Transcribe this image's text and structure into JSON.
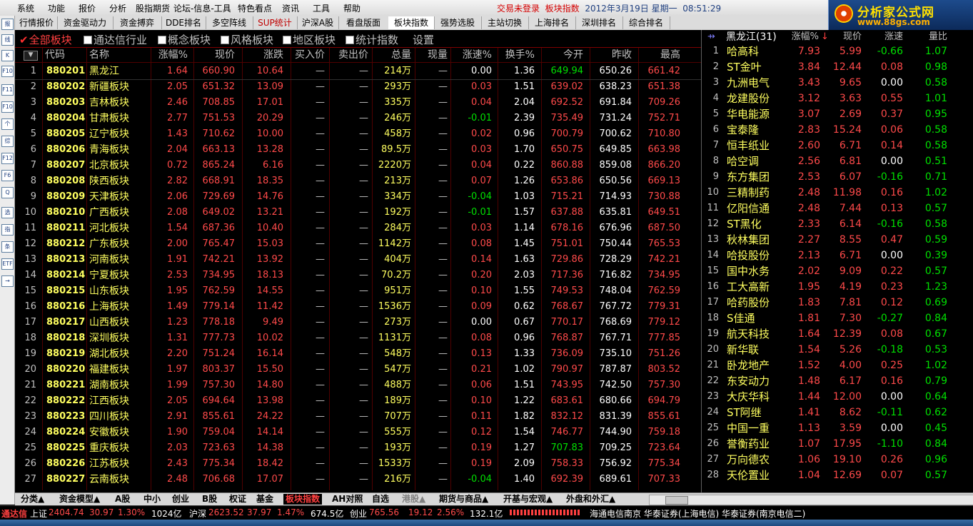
{
  "menu": [
    "系统",
    "功能",
    "报价",
    "分析",
    "股指期货",
    "论坛-信息-工具",
    "特色看点",
    "资讯",
    "工具",
    "帮助"
  ],
  "status": {
    "login": "交易未登录",
    "view": "板块指数",
    "date": "2012年3月19日 星期一",
    "time": "08:51:29"
  },
  "brand": {
    "name": "分析家公式网",
    "url": "www.88gs.com"
  },
  "tabs": [
    "行情报价",
    "资金驱动力",
    "资金搏弈",
    "DDE排名",
    "多空阵线",
    "SUP统计",
    "沪深A股",
    "看盘版面",
    "板块指数",
    "强势选股",
    "主站切换",
    "上海排名",
    "深圳排名",
    "综合排名"
  ],
  "active_tab": "板块指数",
  "left_tools": [
    "报",
    "线",
    "K",
    "F10",
    "F11",
    "F10",
    "个",
    "综",
    "F12",
    "F6",
    "Q",
    "选",
    "指",
    "条",
    "ETF",
    "→"
  ],
  "filters": {
    "all": "全部板块",
    "tdx": "通达信行业",
    "concept": "概念板块",
    "style": "风格板块",
    "region": "地区板块",
    "stats": "统计指数",
    "settings": "设置"
  },
  "table": {
    "headers": [
      "代码",
      "名称",
      "涨幅%",
      "现价",
      "涨跌",
      "买入价",
      "卖出价",
      "总量",
      "现量",
      "涨速%",
      "换手%",
      "今开",
      "昨收",
      "最高"
    ],
    "rows": [
      [
        "1",
        "880201",
        "黑龙江",
        "1.64",
        "660.90",
        "10.64",
        "—",
        "—",
        "214",
        "万",
        "—",
        "0.00",
        "1.36",
        "649.94",
        "650.26",
        "661.42"
      ],
      [
        "2",
        "880202",
        "新疆板块",
        "2.05",
        "651.32",
        "13.09",
        "—",
        "—",
        "293",
        "万",
        "—",
        "0.03",
        "1.51",
        "639.02",
        "638.23",
        "651.38"
      ],
      [
        "3",
        "880203",
        "吉林板块",
        "2.46",
        "708.85",
        "17.01",
        "—",
        "—",
        "335",
        "万",
        "—",
        "0.04",
        "2.04",
        "692.52",
        "691.84",
        "709.26"
      ],
      [
        "4",
        "880204",
        "甘肃板块",
        "2.77",
        "751.53",
        "20.29",
        "—",
        "—",
        "246",
        "万",
        "—",
        "-0.01",
        "2.39",
        "735.49",
        "731.24",
        "752.71"
      ],
      [
        "5",
        "880205",
        "辽宁板块",
        "1.43",
        "710.62",
        "10.00",
        "—",
        "—",
        "458",
        "万",
        "—",
        "0.02",
        "0.96",
        "700.79",
        "700.62",
        "710.80"
      ],
      [
        "6",
        "880206",
        "青海板块",
        "2.04",
        "663.13",
        "13.28",
        "—",
        "—",
        "89.5",
        "万",
        "—",
        "0.03",
        "1.70",
        "650.75",
        "649.85",
        "663.98"
      ],
      [
        "7",
        "880207",
        "北京板块",
        "0.72",
        "865.24",
        "6.16",
        "—",
        "—",
        "2220",
        "万",
        "—",
        "0.04",
        "0.22",
        "860.88",
        "859.08",
        "866.20"
      ],
      [
        "8",
        "880208",
        "陕西板块",
        "2.82",
        "668.91",
        "18.35",
        "—",
        "—",
        "213",
        "万",
        "—",
        "0.07",
        "1.26",
        "653.86",
        "650.56",
        "669.13"
      ],
      [
        "9",
        "880209",
        "天津板块",
        "2.06",
        "729.69",
        "14.76",
        "—",
        "—",
        "334",
        "万",
        "—",
        "-0.04",
        "1.03",
        "715.21",
        "714.93",
        "730.88"
      ],
      [
        "10",
        "880210",
        "广西板块",
        "2.08",
        "649.02",
        "13.21",
        "—",
        "—",
        "192",
        "万",
        "—",
        "-0.01",
        "1.57",
        "637.88",
        "635.81",
        "649.51"
      ],
      [
        "11",
        "880211",
        "河北板块",
        "1.54",
        "687.36",
        "10.40",
        "—",
        "—",
        "284",
        "万",
        "—",
        "0.03",
        "1.14",
        "678.16",
        "676.96",
        "687.50"
      ],
      [
        "12",
        "880212",
        "广东板块",
        "2.00",
        "765.47",
        "15.03",
        "—",
        "—",
        "1142",
        "万",
        "—",
        "0.08",
        "1.45",
        "751.01",
        "750.44",
        "765.53"
      ],
      [
        "13",
        "880213",
        "河南板块",
        "1.91",
        "742.21",
        "13.92",
        "—",
        "—",
        "404",
        "万",
        "—",
        "0.14",
        "1.63",
        "729.86",
        "728.29",
        "742.21"
      ],
      [
        "14",
        "880214",
        "宁夏板块",
        "2.53",
        "734.95",
        "18.13",
        "—",
        "—",
        "70.2",
        "万",
        "—",
        "0.20",
        "2.03",
        "717.36",
        "716.82",
        "734.95"
      ],
      [
        "15",
        "880215",
        "山东板块",
        "1.95",
        "762.59",
        "14.55",
        "—",
        "—",
        "951",
        "万",
        "—",
        "0.10",
        "1.55",
        "749.53",
        "748.04",
        "762.59"
      ],
      [
        "16",
        "880216",
        "上海板块",
        "1.49",
        "779.14",
        "11.42",
        "—",
        "—",
        "1536",
        "万",
        "—",
        "0.09",
        "0.62",
        "768.67",
        "767.72",
        "779.31"
      ],
      [
        "17",
        "880217",
        "山西板块",
        "1.23",
        "778.18",
        "9.49",
        "—",
        "—",
        "273",
        "万",
        "—",
        "0.00",
        "0.67",
        "770.17",
        "768.69",
        "779.12"
      ],
      [
        "18",
        "880218",
        "深圳板块",
        "1.31",
        "777.73",
        "10.02",
        "—",
        "—",
        "1131",
        "万",
        "—",
        "0.08",
        "0.96",
        "768.87",
        "767.71",
        "777.85"
      ],
      [
        "19",
        "880219",
        "湖北板块",
        "2.20",
        "751.24",
        "16.14",
        "—",
        "—",
        "548",
        "万",
        "—",
        "0.13",
        "1.33",
        "736.09",
        "735.10",
        "751.26"
      ],
      [
        "20",
        "880220",
        "福建板块",
        "1.97",
        "803.37",
        "15.50",
        "—",
        "—",
        "547",
        "万",
        "—",
        "0.21",
        "1.02",
        "790.97",
        "787.87",
        "803.52"
      ],
      [
        "21",
        "880221",
        "湖南板块",
        "1.99",
        "757.30",
        "14.80",
        "—",
        "—",
        "488",
        "万",
        "—",
        "0.06",
        "1.51",
        "743.95",
        "742.50",
        "757.30"
      ],
      [
        "22",
        "880222",
        "江西板块",
        "2.05",
        "694.64",
        "13.98",
        "—",
        "—",
        "189",
        "万",
        "—",
        "0.10",
        "1.22",
        "683.61",
        "680.66",
        "694.79"
      ],
      [
        "23",
        "880223",
        "四川板块",
        "2.91",
        "855.61",
        "24.22",
        "—",
        "—",
        "707",
        "万",
        "—",
        "0.11",
        "1.82",
        "832.12",
        "831.39",
        "855.61"
      ],
      [
        "24",
        "880224",
        "安徽板块",
        "1.90",
        "759.04",
        "14.14",
        "—",
        "—",
        "555",
        "万",
        "—",
        "0.12",
        "1.54",
        "746.77",
        "744.90",
        "759.18"
      ],
      [
        "25",
        "880225",
        "重庆板块",
        "2.03",
        "723.63",
        "14.38",
        "—",
        "—",
        "193",
        "万",
        "—",
        "0.19",
        "1.27",
        "707.83",
        "709.25",
        "723.64"
      ],
      [
        "26",
        "880226",
        "江苏板块",
        "2.43",
        "775.34",
        "18.42",
        "—",
        "—",
        "1533",
        "万",
        "—",
        "0.19",
        "2.09",
        "758.33",
        "756.92",
        "775.34"
      ],
      [
        "27",
        "880227",
        "云南板块",
        "2.48",
        "706.68",
        "17.07",
        "—",
        "—",
        "216",
        "万",
        "—",
        "-0.04",
        "1.40",
        "692.39",
        "689.61",
        "707.33"
      ]
    ]
  },
  "right_panel": {
    "title": "黑龙江(31)",
    "headers": [
      "涨幅%",
      "现价",
      "涨速",
      "量比"
    ],
    "rows": [
      [
        "1",
        "哈高科",
        "7.93",
        "5.99",
        "-0.66",
        "1.07"
      ],
      [
        "2",
        "ST金叶",
        "3.84",
        "12.44",
        "0.08",
        "0.98"
      ],
      [
        "3",
        "九洲电气",
        "3.43",
        "9.65",
        "0.00",
        "0.58"
      ],
      [
        "4",
        "龙建股份",
        "3.12",
        "3.63",
        "0.55",
        "1.01"
      ],
      [
        "5",
        "华电能源",
        "3.07",
        "2.69",
        "0.37",
        "0.95"
      ],
      [
        "6",
        "宝泰隆",
        "2.83",
        "15.24",
        "0.06",
        "0.58"
      ],
      [
        "7",
        "恒丰纸业",
        "2.60",
        "6.71",
        "0.14",
        "0.58"
      ],
      [
        "8",
        "哈空调",
        "2.56",
        "6.81",
        "0.00",
        "0.51"
      ],
      [
        "9",
        "东方集团",
        "2.53",
        "6.07",
        "-0.16",
        "0.71"
      ],
      [
        "10",
        "三精制药",
        "2.48",
        "11.98",
        "0.16",
        "1.02"
      ],
      [
        "11",
        "亿阳信通",
        "2.48",
        "7.44",
        "0.13",
        "0.57"
      ],
      [
        "12",
        "ST黑化",
        "2.33",
        "6.14",
        "-0.16",
        "0.58"
      ],
      [
        "13",
        "秋林集团",
        "2.27",
        "8.55",
        "0.47",
        "0.59"
      ],
      [
        "14",
        "哈投股份",
        "2.13",
        "6.71",
        "0.00",
        "0.39"
      ],
      [
        "15",
        "国中水务",
        "2.02",
        "9.09",
        "0.22",
        "0.57"
      ],
      [
        "16",
        "工大高新",
        "1.95",
        "4.19",
        "0.23",
        "1.23"
      ],
      [
        "17",
        "哈药股份",
        "1.83",
        "7.81",
        "0.12",
        "0.69"
      ],
      [
        "18",
        "S佳通",
        "1.81",
        "7.30",
        "-0.27",
        "0.84"
      ],
      [
        "19",
        "航天科技",
        "1.64",
        "12.39",
        "0.08",
        "0.67"
      ],
      [
        "20",
        "新华联",
        "1.54",
        "5.26",
        "-0.18",
        "0.53"
      ],
      [
        "21",
        "卧龙地产",
        "1.52",
        "4.00",
        "0.25",
        "1.02"
      ],
      [
        "22",
        "东安动力",
        "1.48",
        "6.17",
        "0.16",
        "0.79"
      ],
      [
        "23",
        "大庆华科",
        "1.44",
        "12.00",
        "0.00",
        "0.64"
      ],
      [
        "24",
        "ST阿继",
        "1.41",
        "8.62",
        "-0.11",
        "0.62"
      ],
      [
        "25",
        "中国一重",
        "1.13",
        "3.59",
        "0.00",
        "0.45"
      ],
      [
        "26",
        "誉衡药业",
        "1.07",
        "17.95",
        "-1.10",
        "0.84"
      ],
      [
        "27",
        "万向德农",
        "1.06",
        "19.10",
        "0.26",
        "0.96"
      ],
      [
        "28",
        "天伦置业",
        "1.04",
        "12.69",
        "0.07",
        "0.57"
      ]
    ]
  },
  "sheet_tabs": [
    "分类▲",
    "资金模型▲",
    "A股",
    "中小",
    "创业",
    "B股",
    "权证",
    "基金",
    "板块指数",
    "AH对照",
    "自选",
    "港股▲",
    "期货与商品▲",
    "开基与宏观▲",
    "外盘和外汇▲"
  ],
  "statusbar": {
    "app": "通达信",
    "sh_label": "上证",
    "sh_val": "2404.74",
    "sh_chg": "30.97",
    "sh_pct": "1.30%",
    "sh_amt": "1024亿",
    "hs_label": "沪深",
    "hs_val": "2623.52",
    "hs_chg": "37.97",
    "hs_pct": "1.47%",
    "hs_amt": "674.5亿",
    "cy_label": "创业",
    "cy_val": "765.56",
    "cy_chg": "19.12",
    "cy_pct": "2.56%",
    "cy_amt": "132.1亿",
    "server": "海通电信南京 华泰证券(上海电信) 华泰证券(南京电信二)"
  },
  "colors": {
    "up": "#ff4a4a",
    "down": "#00e000",
    "flat": "#ffffff",
    "code": "#ffff60",
    "grid": "#500000"
  }
}
